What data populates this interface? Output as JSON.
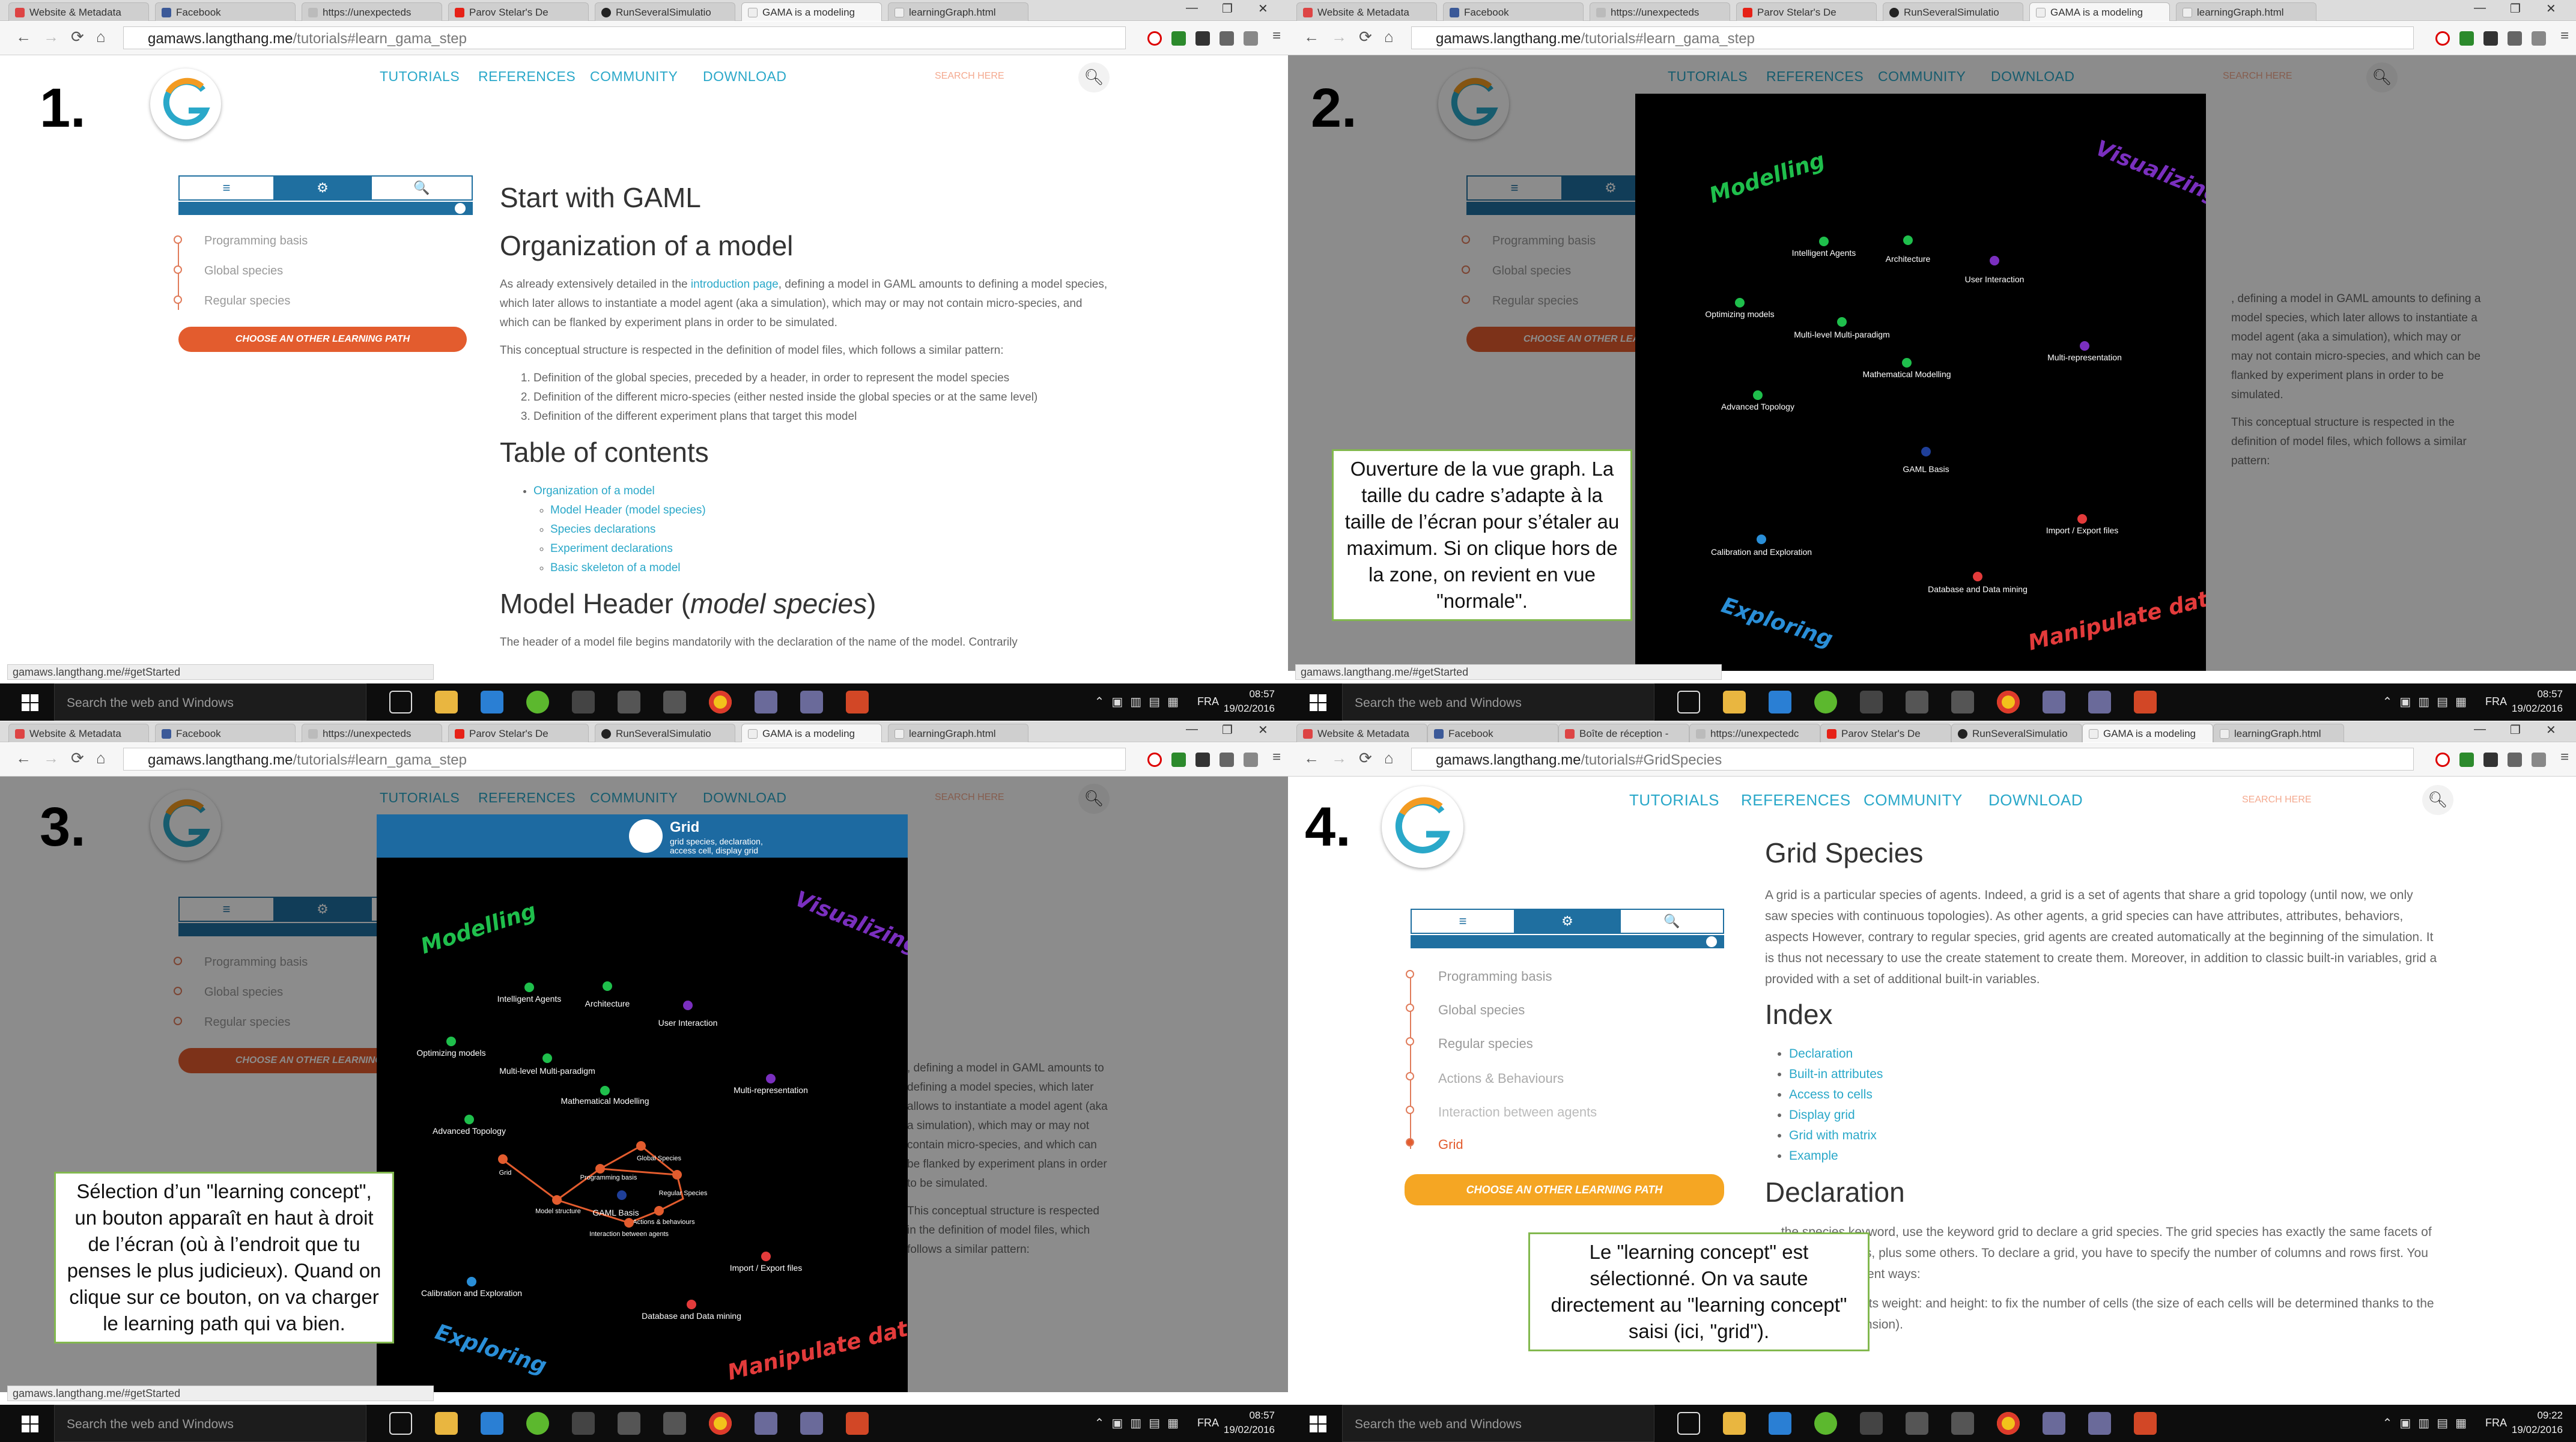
{
  "browser": {
    "tabs": [
      "Website & Metadata",
      "Facebook",
      "https://unexpecteds",
      "Parov Stelar's De",
      "RunSeveralSimulatio",
      "GAMA is a modeling",
      "learningGraph.html"
    ],
    "tabs_p4": [
      "Website & Metadata",
      "Facebook",
      "Boîte de réception -",
      "https://unexpectedc",
      "Parov Stelar's De",
      "RunSeveralSimulatio",
      "GAMA is a modeling",
      "learningGraph.html"
    ],
    "url_host": "gamaws.langthang.me",
    "url_path_a": "/tutorials#learn_gama_step",
    "url_path_b": "/tutorials#GridSpecies",
    "status_url": "gamaws.langthang.me/#getStarted"
  },
  "site": {
    "nav": [
      "TUTORIALS",
      "REFERENCES",
      "COMMUNITY",
      "DOWNLOAD"
    ],
    "search_placeholder": "SEARCH HERE",
    "menu_tabs": [
      "≡",
      "⚙",
      "🔍"
    ],
    "path_items": [
      "Programming basis",
      "Global species",
      "Regular species"
    ],
    "path_items_p4": [
      "Programming basis",
      "Global species",
      "Regular species",
      "Actions & Behaviours",
      "Interaction between agents",
      "Grid"
    ],
    "choose_button": "CHOOSE AN OTHER LEARNING PATH"
  },
  "page1": {
    "h1": "Start with GAML",
    "h2": "Organization of a model",
    "p1a": "As already extensively detailed in the ",
    "p1link": "introduction page",
    "p1b": ", defining a model in GAML amounts to defining a model species, which later allows to instantiate a model agent (aka a simulation), which may or may not contain micro-species, and which can be flanked by experiment plans in order to be simulated.",
    "p2": "This conceptual structure is respected in the definition of model files, which follows a similar pattern:",
    "ol": [
      "Definition of the global species, preceded by a header, in order to represent the model species",
      "Definition of the different micro-species (either nested inside the global species or at the same level)",
      "Definition of the different experiment plans that target this model"
    ],
    "toc_title": "Table of contents",
    "toc": [
      "Organization of a model",
      "Model Header (model species)",
      "Species declarations",
      "Experiment declarations",
      "Basic skeleton of a model"
    ],
    "h3a": "Model Header (",
    "h3b": "model species",
    ")": ")",
    "p3": "The header of a model file begins mandatorily with the declaration of the name of the model. Contrarily"
  },
  "page4": {
    "h1": "Grid Species",
    "p1": "A grid is a particular species of agents. Indeed, a grid is a set of agents that share a grid topology (until now, we only saw species with continuous topologies). As other agents, a grid species can have attributes, attributes, behaviors, aspects However, contrary to regular species, grid agents are created automatically at the beginning of the simulation. It is thus not necessary to use the create statement to create them. Moreover, in addition to classic built-in variables, grid a provided with a set of additional built-in variables.",
    "index_title": "Index",
    "index": [
      "Declaration",
      "Built-in attributes",
      "Access to cells",
      "Display grid",
      "Grid with matrix",
      "Example"
    ],
    "h2": "Declaration",
    "p2": "… the species keyword, use the keyword grid to declare a grid species. The grid species has exactly the same facets of the regular species, plus some others. To declare a grid, you have to specify the number of columns and rows first. You can do it two different ways:",
    "p3": "Using the two facets weight: and height: to fix the number of cells (the size of each cells will be determined thanks to the environment dimension)."
  },
  "graph": {
    "areas": {
      "modelling": "Modelling",
      "visualizing": "Visualizing",
      "exploring": "Exploring",
      "manipulate": "Manipulate data"
    },
    "nodes": [
      "Intelligent Agents",
      "Architecture",
      "User Interaction",
      "Optimizing models",
      "Multi-level Multi-paradigm",
      "Multi-representation",
      "Mathematical Modelling",
      "Advanced Topology",
      "GAML Basis",
      "Calibration and Exploration",
      "Import / Export files",
      "Database and Data mining"
    ],
    "sub": [
      "Programming basis",
      "Global Species",
      "Regular Species",
      "Model structure",
      "Actions & behaviours",
      "Interaction between agents",
      "Grid"
    ],
    "head_title": "Grid",
    "head_sub": "grid species, declaration, access cell, display grid"
  },
  "notes": {
    "n2": "Ouverture de la vue graph. La taille du cadre s’adapte à la taille de l’écran pour s’étaler au maximum. Si on clique hors de la zone, on revient en vue \"normale\".",
    "n3": "Sélection d’un \"learning concept\", un bouton apparaît en haut à droit de l’écran (où à l’endroit que tu penses le plus judicieux). Quand on clique sur ce bouton, on va charger le learning path qui va bien.",
    "n4": "Le \"learning concept\" est sélectionné. On va saute directement au \"learning concept\" saisi (ici, \"grid\")."
  },
  "panel_numbers": [
    "1.",
    "2.",
    "3.",
    "4."
  ],
  "taskbar": {
    "search": "Search the web and Windows",
    "lang": "FRA",
    "date": "19/02/2016",
    "times": [
      "08:57",
      "08:57",
      "08:57",
      "09:22"
    ]
  },
  "colors": {
    "accent": "#2aa8c9",
    "brand_blue": "#1f6fa0",
    "orange": "#e35c2e",
    "green": "#1fbf4c",
    "purple": "#7a2fbf",
    "red": "#e33b3b",
    "blue": "#2a8fd8"
  }
}
